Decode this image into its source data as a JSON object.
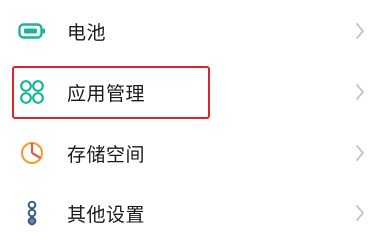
{
  "settings": {
    "items": [
      {
        "label": "电池",
        "icon": "battery-icon",
        "icon_color": "#1bb39a"
      },
      {
        "label": "应用管理",
        "icon": "apps-grid-icon",
        "icon_color": "#1bb39a"
      },
      {
        "label": "存储空间",
        "icon": "storage-pie-icon",
        "icon_color": "#f0a23a"
      },
      {
        "label": "其他设置",
        "icon": "more-settings-icon",
        "icon_color": "#3d5a8a"
      }
    ],
    "highlight_color": "#d9262b"
  }
}
